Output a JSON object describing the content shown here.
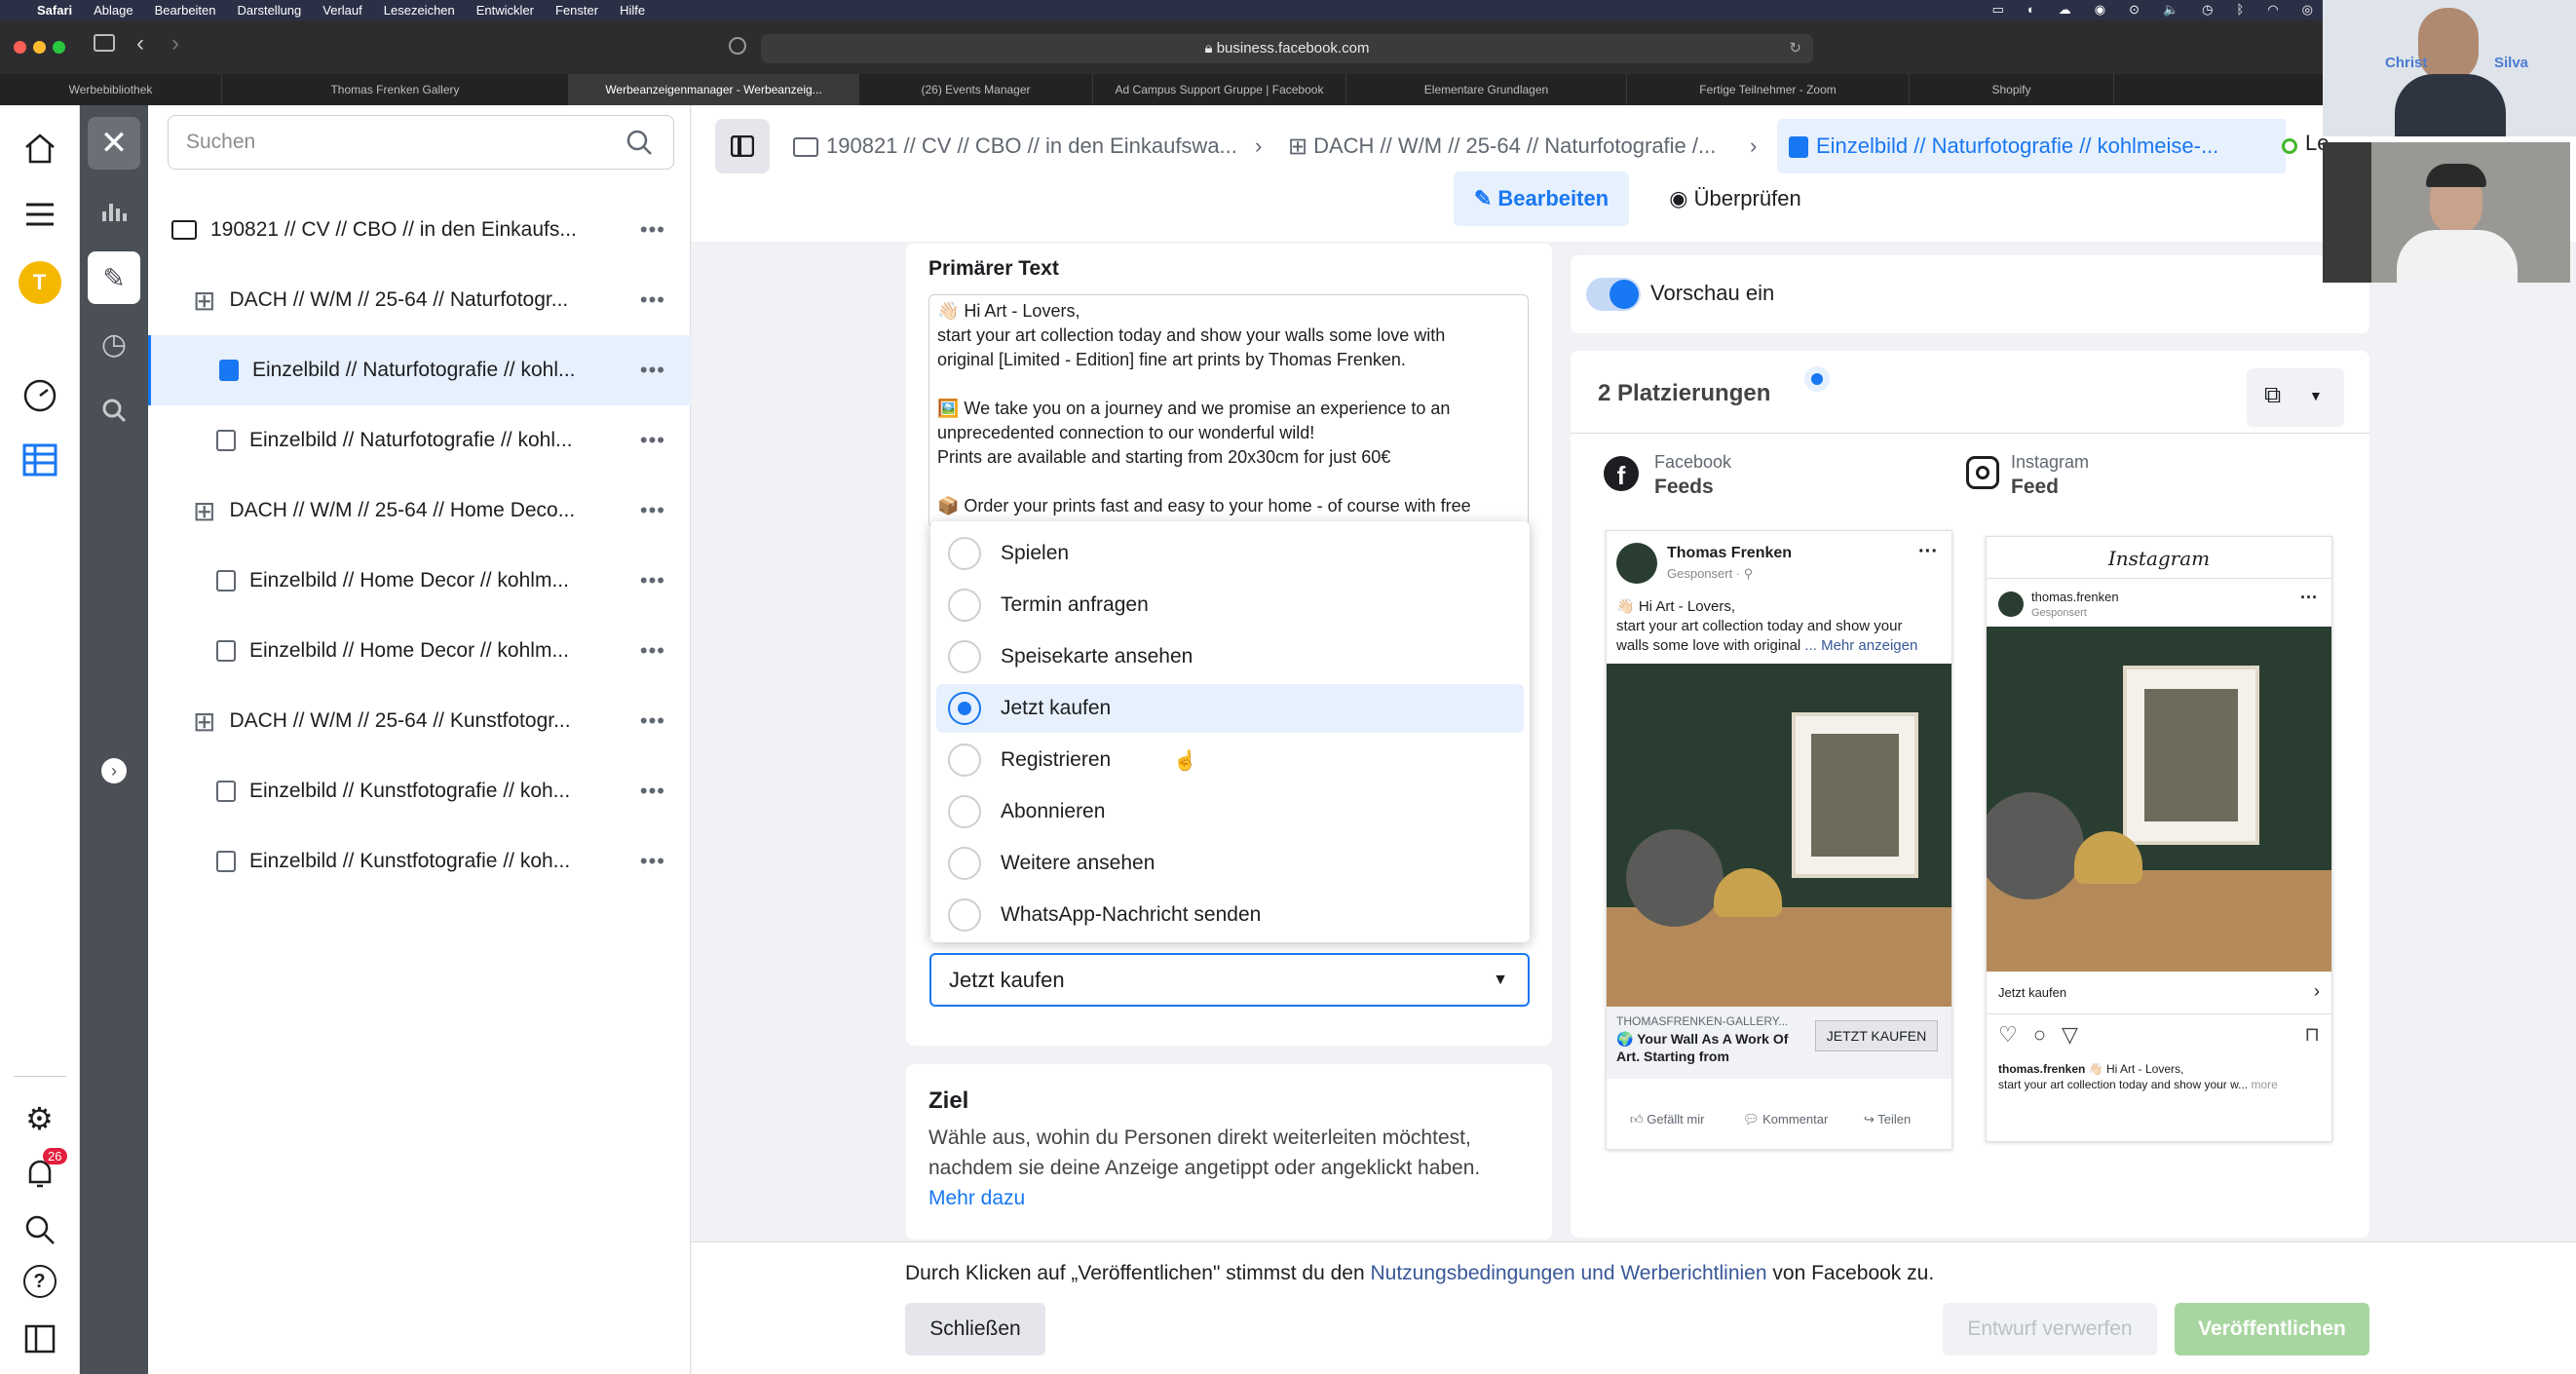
{
  "menubar": {
    "app": "Safari",
    "items": [
      "Ablage",
      "Bearbeiten",
      "Darstellung",
      "Verlauf",
      "Lesezeichen",
      "Entwickler",
      "Fenster",
      "Hilfe"
    ]
  },
  "browser": {
    "url": "business.facebook.com",
    "tabs": [
      "Werbebibliothek",
      "Thomas Frenken Gallery",
      "Werbeanzeigenmanager - Werbeanzeig...",
      "(26) Events Manager",
      "Ad Campus Support Gruppe | Facebook",
      "Elementare Grundlagen",
      "Fertige Teilnehmer - Zoom",
      "Shopify"
    ]
  },
  "rail": {
    "avatar_letter": "T",
    "notif_count": "26"
  },
  "tree": {
    "search_placeholder": "Suchen",
    "rows": [
      {
        "label": "190821 // CV // CBO // in den Einkaufs...",
        "type": "campaign"
      },
      {
        "label": "DACH // W/M // 25-64 // Naturfotogr...",
        "type": "adset"
      },
      {
        "label": "Einzelbild // Naturfotografie // kohl...",
        "type": "ad",
        "selected": true
      },
      {
        "label": "Einzelbild // Naturfotografie // kohl...",
        "type": "ad"
      },
      {
        "label": "DACH // W/M // 25-64 // Home Deco...",
        "type": "adset"
      },
      {
        "label": "Einzelbild // Home Decor // kohlm...",
        "type": "ad"
      },
      {
        "label": "Einzelbild // Home Decor // kohlm...",
        "type": "ad"
      },
      {
        "label": "DACH // W/M // 25-64 // Kunstfotogr...",
        "type": "adset"
      },
      {
        "label": "Einzelbild // Kunstfotografie // koh...",
        "type": "ad"
      },
      {
        "label": "Einzelbild // Kunstfotografie // koh...",
        "type": "ad"
      }
    ]
  },
  "header": {
    "crumb1": "190821 // CV // CBO // in den Einkaufswa...",
    "crumb2": "DACH // W/M // 25-64 // Naturfotografie /...",
    "crumb3": "Einzelbild // Naturfotografie // kohlmeise-...",
    "status_cut": "Le",
    "edit": "Bearbeiten",
    "review": "Überprüfen"
  },
  "primary_text": {
    "label": "Primärer Text",
    "lines": [
      "👋🏻 Hi Art - Lovers,",
      "start your art collection today and show your walls some love with",
      "original [Limited - Edition] fine art prints by Thomas Frenken.",
      "",
      "🖼️ We take you on a journey and we promise an experience to an",
      "unprecedented connection to our wonderful wild!",
      "Prints are available and starting from 20x30cm for just 60€",
      "",
      "📦 Order your prints fast and easy to your home - of course with free"
    ]
  },
  "cta_options": [
    "Spielen",
    "Termin anfragen",
    "Speisekarte ansehen",
    "Jetzt kaufen",
    "Registrieren",
    "Abonnieren",
    "Weitere ansehen",
    "WhatsApp-Nachricht senden"
  ],
  "cta_selected": "Jetzt kaufen",
  "goal": {
    "title": "Ziel",
    "desc1": "Wähle aus, wohin du Personen direkt weiterleiten möchtest,",
    "desc2": "nachdem sie deine Anzeige angetippt oder angeklickt haben.",
    "more": "Mehr dazu"
  },
  "preview": {
    "toggle_label": "Vorschau ein",
    "placements_title": "2 Platzierungen",
    "fb_platform": "Facebook",
    "fb_place": "Feeds",
    "ig_platform": "Instagram",
    "ig_place": "Feed",
    "fb_post": {
      "page": "Thomas Frenken",
      "sponsored": "Gesponsert · ⚲",
      "text1": "👋🏻 Hi Art - Lovers,",
      "text2": "start your art collection today and show your",
      "text3": "walls some love with original",
      "more": "... Mehr anzeigen",
      "domain": "THOMASFRENKEN-GALLERY...",
      "headline1": "🌍 Your Wall As A Work Of",
      "headline2": "Art. Starting from",
      "cta": "JETZT KAUFEN",
      "like": "Gefällt mir",
      "comment": "Kommentar",
      "share": "Teilen"
    },
    "ig_post": {
      "logo": "Instagram",
      "user": "thomas.frenken",
      "sponsored": "Gesponsert",
      "cta": "Jetzt kaufen",
      "cap_user": "thomas.frenken",
      "cap1": "👋🏻 Hi Art - Lovers,",
      "cap2": "start your art collection today and show your w...",
      "more": "more"
    }
  },
  "footer": {
    "text_pre": "Durch Klicken auf „Veröffentlichen\" stimmst du den",
    "link": "Nutzungsbedingungen und Werberichtlinien",
    "text_post": "von Facebook zu.",
    "close": "Schließen",
    "discard": "Entwurf verwerfen",
    "publish": "Veröffentlichen"
  },
  "video": {
    "name1": "Christ",
    "name2": "Silva"
  },
  "colors": {
    "accent": "#1877f2",
    "publish": "#a8d6a0",
    "frame_green": "#2a3d31"
  }
}
